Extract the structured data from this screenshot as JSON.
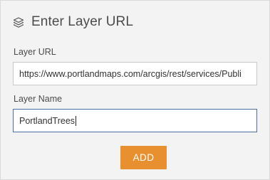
{
  "header": {
    "icon": "layers-icon",
    "title": "Enter Layer URL"
  },
  "layer_url": {
    "label": "Layer URL",
    "value": "https://www.portlandmaps.com/arcgis/rest/services/Publi"
  },
  "layer_name": {
    "label": "Layer Name",
    "value": "PortlandTrees"
  },
  "add_button": {
    "label": "ADD"
  },
  "colors": {
    "panel_bg": "#f3f3f3",
    "accent": "#e8902f",
    "focus_border": "#4a6ea0"
  }
}
